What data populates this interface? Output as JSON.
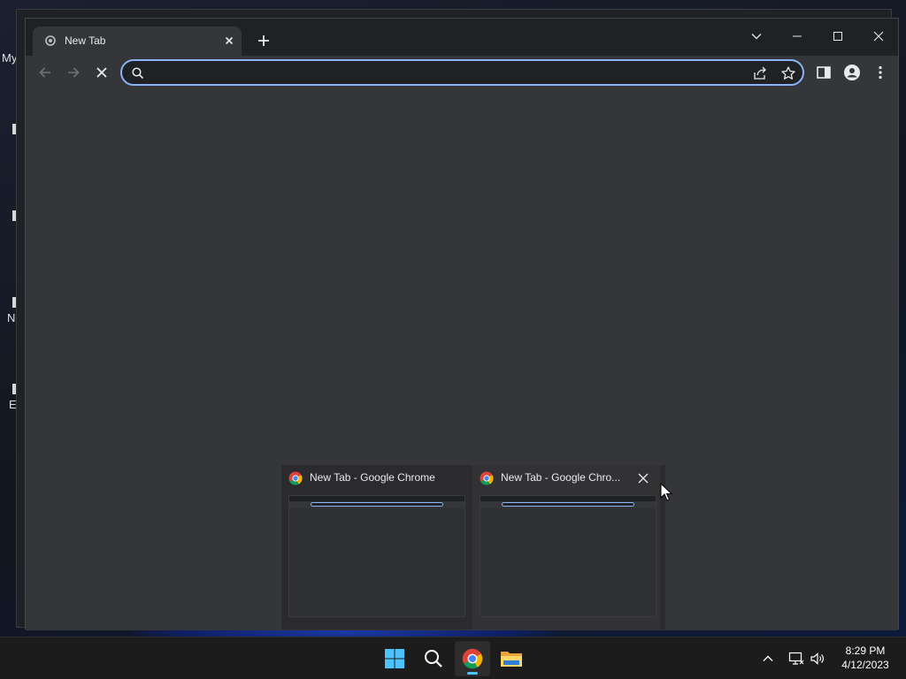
{
  "desktop": {
    "labels": [
      "My",
      "N",
      "E"
    ]
  },
  "browser": {
    "tab": {
      "title": "New Tab",
      "favicon": "chrome-favicon-icon"
    },
    "tab_close_icon": "close-icon",
    "new_tab_icon": "plus-icon",
    "window_controls": [
      "tab-search-chevron-icon",
      "minimize-icon",
      "maximize-icon",
      "close-icon"
    ],
    "toolbar": {
      "back_icon": "arrow-left-icon",
      "forward_icon": "arrow-right-icon",
      "stop_icon": "stop-loading-icon"
    },
    "omnibox": {
      "value": "",
      "placeholder": ""
    },
    "omnibox_icons": [
      "search-icon",
      "share-icon",
      "star-icon"
    ],
    "toolbar_icons": [
      "side-panel-icon",
      "profile-icon",
      "more-vert-icon"
    ],
    "accent_color": "#8ab4f8"
  },
  "thumbnails": [
    {
      "title": "New Tab - Google Chrome",
      "icon": "chrome-logo-icon"
    },
    {
      "title": "New Tab - Google Chro...",
      "icon": "chrome-logo-icon",
      "close_icon": "close-icon"
    }
  ],
  "taskbar": {
    "apps": [
      "windows-start-icon",
      "search-icon",
      "chrome-logo-icon",
      "file-explorer-icon"
    ],
    "active_app": "chrome-logo-icon",
    "active_indicator_color": "#4cc2ff",
    "tray_icons": [
      "chevron-up-icon",
      "network-icon",
      "volume-icon"
    ],
    "time": "8:29 PM",
    "date": "4/12/2023"
  }
}
